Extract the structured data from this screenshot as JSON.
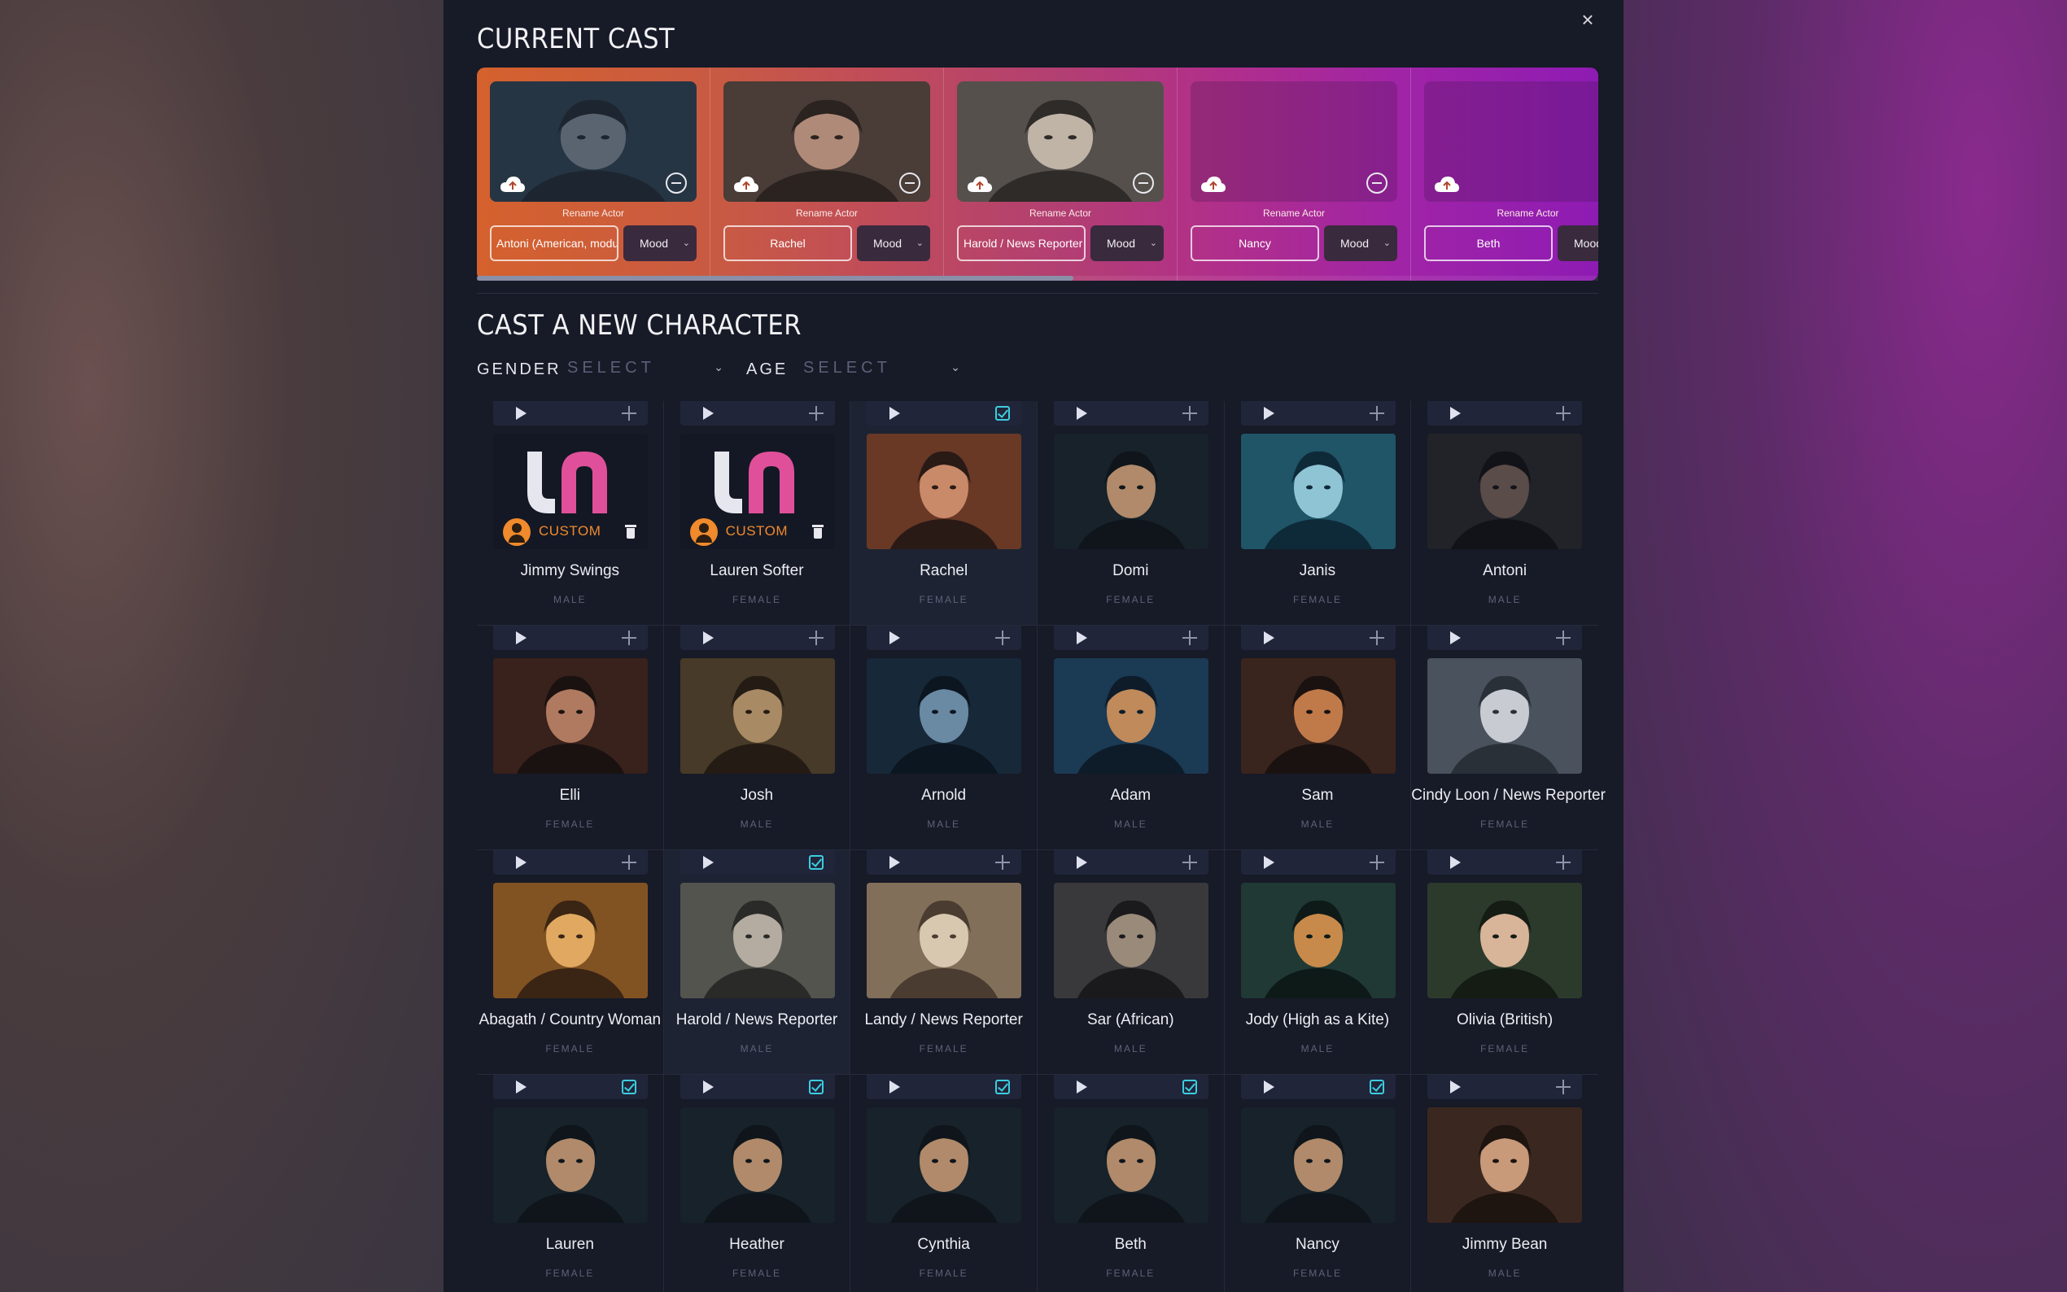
{
  "modal": {
    "close_label": "×"
  },
  "current_cast": {
    "title": "CURRENT CAST",
    "rename_label": "Rename Actor",
    "actors": [
      {
        "name": "Antoni (American, modu",
        "mood": "Mood",
        "has_photo": true,
        "tone": [
          "#2c3e4d",
          "#1d2630",
          "#5a6470"
        ]
      },
      {
        "name": "Rachel",
        "mood": "Mood",
        "has_photo": true,
        "tone": [
          "#5b4a42",
          "#2a2320",
          "#b08a78"
        ]
      },
      {
        "name": "Harold / News Reporter",
        "mood": "Mood",
        "has_photo": true,
        "tone": [
          "#6a6560",
          "#2e2b28",
          "#c0b4a6"
        ]
      },
      {
        "name": "Nancy",
        "mood": "Mood",
        "has_photo": false
      },
      {
        "name": "Beth",
        "mood": "Mood",
        "has_photo": false
      }
    ]
  },
  "new_character": {
    "title": "CAST A NEW CHARACTER",
    "gender_label": "GENDER",
    "gender_value": "SELECT",
    "age_label": "AGE",
    "age_value": "SELECT",
    "custom_label": "CUSTOM",
    "characters": [
      {
        "name": "Jimmy Swings",
        "gender": "MALE",
        "added": false,
        "custom": true
      },
      {
        "name": "Lauren Softer",
        "gender": "FEMALE",
        "added": false,
        "custom": true
      },
      {
        "name": "Rachel",
        "gender": "FEMALE",
        "added": true,
        "tone": [
          "#8a4a2e",
          "#2a1a16",
          "#c98a6a"
        ]
      },
      {
        "name": "Domi",
        "gender": "FEMALE",
        "added": false,
        "tone": [
          "#1c2a34",
          "#0f151b",
          "#b08a6a"
        ]
      },
      {
        "name": "Janis",
        "gender": "FEMALE",
        "added": false,
        "tone": [
          "#2a6a80",
          "#0e2a38",
          "#8fc4d4"
        ]
      },
      {
        "name": "Antoni",
        "gender": "MALE",
        "added": false,
        "tone": [
          "#2a2c34",
          "#121318",
          "#5a4c48"
        ]
      },
      {
        "name": "Elli",
        "gender": "FEMALE",
        "added": false,
        "tone": [
          "#4a2a22",
          "#1a1210",
          "#b07a60"
        ]
      },
      {
        "name": "Josh",
        "gender": "MALE",
        "added": false,
        "tone": [
          "#5a4a34",
          "#241c14",
          "#a88a64"
        ]
      },
      {
        "name": "Arnold",
        "gender": "MALE",
        "added": false,
        "tone": [
          "#1e3448",
          "#0c1620",
          "#6a8aa4"
        ]
      },
      {
        "name": "Adam",
        "gender": "MALE",
        "added": false,
        "tone": [
          "#224a6a",
          "#0e1c2a",
          "#c08a5a"
        ]
      },
      {
        "name": "Sam",
        "gender": "MALE",
        "added": false,
        "tone": [
          "#4a3024",
          "#1a1210",
          "#c07a4a"
        ]
      },
      {
        "name": "Cindy Loon / News Reporter",
        "gender": "FEMALE",
        "added": false,
        "tone": [
          "#5a6470",
          "#2a3038",
          "#c8ccd2"
        ]
      },
      {
        "name": "Abagath / Country Woman",
        "gender": "FEMALE",
        "added": false,
        "tone": [
          "#a86a2a",
          "#3a2414",
          "#e0a860"
        ]
      },
      {
        "name": "Harold / News Reporter",
        "gender": "MALE",
        "added": true,
        "tone": [
          "#6a6a64",
          "#2a2a28",
          "#b4aca0"
        ]
      },
      {
        "name": "Landy / News Reporter",
        "gender": "FEMALE",
        "added": false,
        "tone": [
          "#a08a70",
          "#4a3c30",
          "#d8c8b0"
        ]
      },
      {
        "name": "Sar (African)",
        "gender": "MALE",
        "added": false,
        "tone": [
          "#4a4a4c",
          "#1a1a1c",
          "#9a8a7a"
        ]
      },
      {
        "name": "Jody (High as a Kite)",
        "gender": "MALE",
        "added": false,
        "tone": [
          "#2a4a44",
          "#0e1a18",
          "#c88a4a"
        ]
      },
      {
        "name": "Olivia (British)",
        "gender": "FEMALE",
        "added": false,
        "tone": [
          "#3a4a3a",
          "#141c14",
          "#d8b498"
        ]
      },
      {
        "name": "Lauren",
        "gender": "FEMALE",
        "added": true,
        "tone": [
          "#1c2a34",
          "#0f151b",
          "#b08a6a"
        ]
      },
      {
        "name": "Heather",
        "gender": "FEMALE",
        "added": true,
        "tone": [
          "#1c2a34",
          "#0f151b",
          "#b08a6a"
        ]
      },
      {
        "name": "Cynthia",
        "gender": "FEMALE",
        "added": true,
        "tone": [
          "#1c2a34",
          "#0f151b",
          "#b08a6a"
        ]
      },
      {
        "name": "Beth",
        "gender": "FEMALE",
        "added": true,
        "tone": [
          "#1c2a34",
          "#0f151b",
          "#b08a6a"
        ]
      },
      {
        "name": "Nancy",
        "gender": "FEMALE",
        "added": true,
        "tone": [
          "#1c2a34",
          "#0f151b",
          "#b08a6a"
        ]
      },
      {
        "name": "Jimmy Bean",
        "gender": "MALE",
        "added": false,
        "tone": [
          "#4a3428",
          "#1e1410",
          "#c89a7a"
        ]
      }
    ]
  },
  "colors": {
    "accent_check": "#3ccde0",
    "custom_orange": "#f08a2c",
    "logo_pink": "#e0509a",
    "logo_white": "#e6e6ee"
  }
}
